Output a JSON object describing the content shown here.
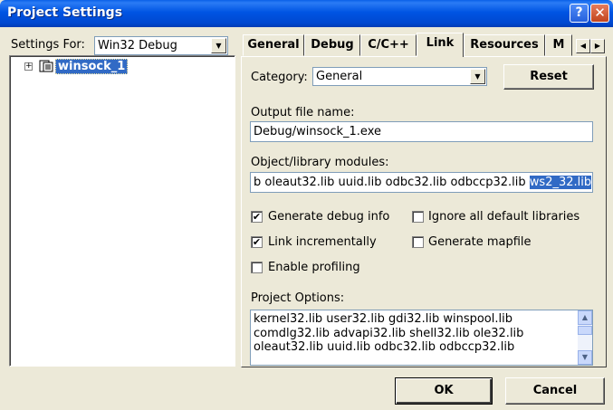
{
  "window": {
    "title": "Project Settings"
  },
  "left": {
    "settings_for_label": "Settings For:",
    "target_value": "Win32 Debug",
    "tree_expander": "+",
    "tree_item": "winsock_1"
  },
  "tabs": [
    "General",
    "Debug",
    "C/C++",
    "Link",
    "Resources",
    "M"
  ],
  "active_tab": "Link",
  "link": {
    "category_label": "Category:",
    "category_value": "General",
    "reset_label": "Reset",
    "output_label": "Output file name:",
    "output_value": "Debug/winsock_1.exe",
    "modules_label": "Object/library modules:",
    "modules_value_plain": "b oleaut32.lib uuid.lib odbc32.lib odbccp32.lib ",
    "modules_value_selected": "ws2_32.lib",
    "checkboxes": [
      {
        "label": "Generate debug info",
        "checked": true,
        "mark": "✔"
      },
      {
        "label": "Ignore all default libraries",
        "checked": false,
        "mark": ""
      },
      {
        "label": "Link incrementally",
        "checked": true,
        "mark": "✔"
      },
      {
        "label": "Generate mapfile",
        "checked": false,
        "mark": ""
      },
      {
        "label": "Enable profiling",
        "checked": false,
        "mark": ""
      }
    ],
    "options_label": "Project Options:",
    "options_lines": [
      "kernel32.lib user32.lib gdi32.lib winspool.lib",
      "comdlg32.lib advapi32.lib shell32.lib ole32.lib",
      "oleaut32.lib uuid.lib odbc32.lib odbccp32.lib"
    ]
  },
  "footer": {
    "ok_label": "OK",
    "cancel_label": "Cancel"
  },
  "colors": {
    "title_bar": "#0054e3",
    "selection": "#316ac5",
    "dialog_bg": "#ece9d8"
  }
}
